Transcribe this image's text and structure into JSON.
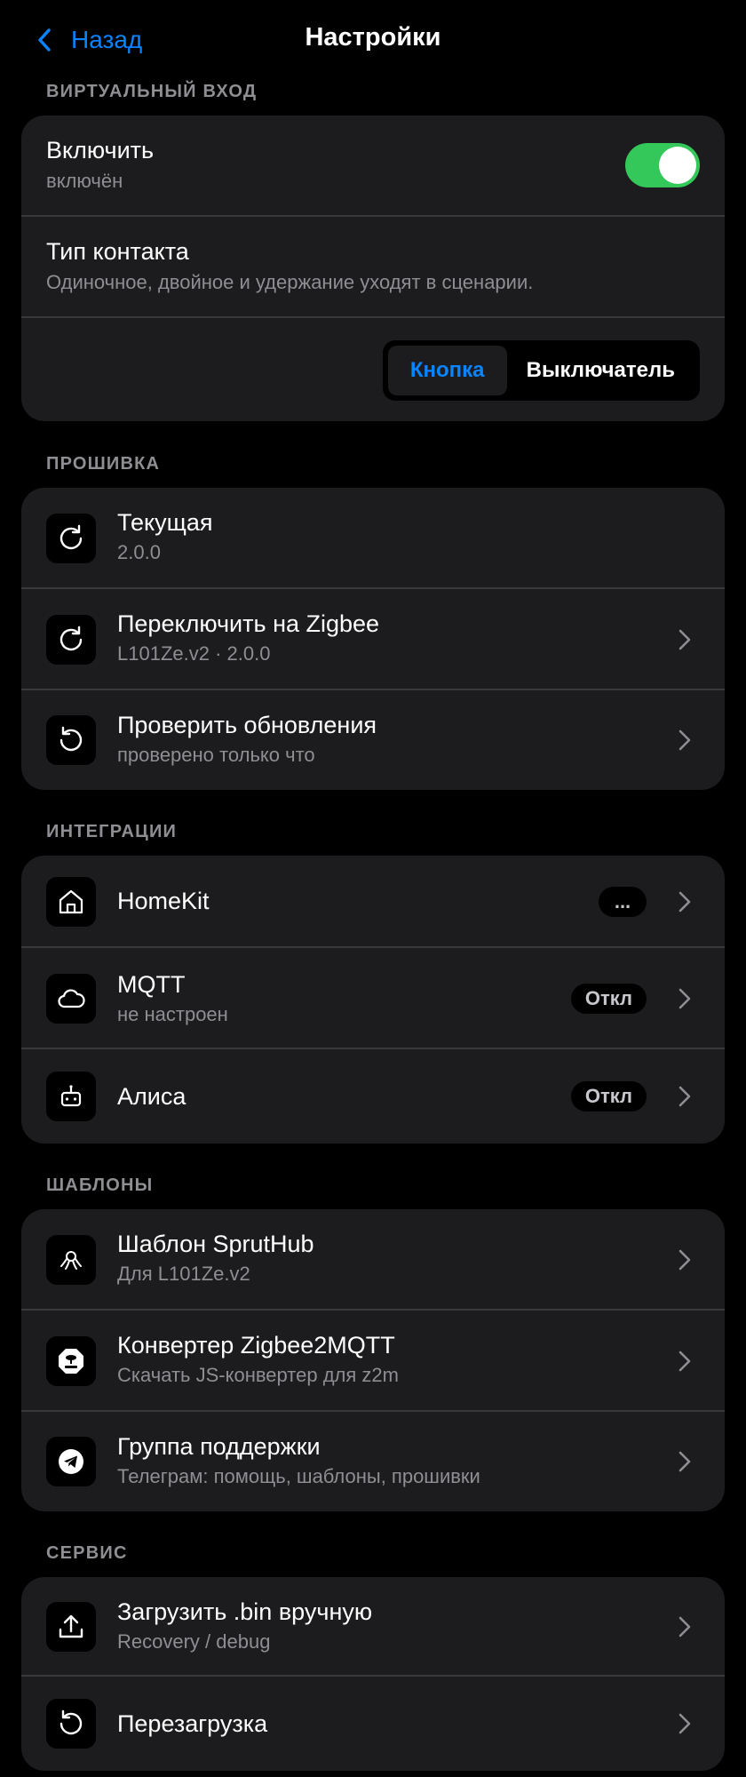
{
  "header": {
    "back_label": "Назад",
    "title": "Настройки"
  },
  "virtual": {
    "section": "ВИРТУАЛЬНЫЙ ВХОД",
    "enable_title": "Включить",
    "enable_state": "включён",
    "enable_on": true,
    "contact_title": "Тип контакта",
    "contact_desc": "Одиночное, двойное и удержание уходят в сценарии.",
    "seg_options": [
      "Кнопка",
      "Выключатель"
    ],
    "seg_selected": "Кнопка"
  },
  "firmware": {
    "section": "ПРОШИВКА",
    "items": [
      {
        "title": "Текущая",
        "subtitle": "2.0.0",
        "icon": "refresh-icon"
      },
      {
        "title": "Переключить на Zigbee",
        "subtitle": "L101Ze.v2 · 2.0.0",
        "icon": "refresh-icon"
      },
      {
        "title": "Проверить обновления",
        "subtitle": "проверено только что",
        "icon": "rotate-ccw-icon"
      }
    ]
  },
  "integrations": {
    "section": "ИНТЕГРАЦИИ",
    "items": [
      {
        "title": "HomeKit",
        "badge": "...",
        "icon": "home-icon"
      },
      {
        "title": "MQTT",
        "subtitle": "не настроен",
        "badge": "Откл",
        "icon": "cloud-icon"
      },
      {
        "title": "Алиса",
        "badge": "Откл",
        "icon": "robot-icon"
      }
    ]
  },
  "templates": {
    "section": "ШАБЛОНЫ",
    "items": [
      {
        "title": "Шаблон SprutHub",
        "subtitle": "Для L101Ze.v2",
        "icon": "octopus-icon"
      },
      {
        "title": "Конвертер Zigbee2MQTT",
        "subtitle": "Скачать JS-конвертер для z2m",
        "icon": "z2m-bee-icon"
      },
      {
        "title": "Группа поддержки",
        "subtitle": "Телеграм: помощь, шаблоны, прошивки",
        "icon": "telegram-icon"
      }
    ]
  },
  "service": {
    "section": "СЕРВИС",
    "items": [
      {
        "title": "Загрузить .bin вручную",
        "subtitle": "Recovery / debug",
        "icon": "upload-icon"
      },
      {
        "title": "Перезагрузка",
        "icon": "rotate-ccw-icon"
      }
    ]
  },
  "colors": {
    "accent": "#0a84ff",
    "toggle_on": "#34c759",
    "card": "#1c1c1e",
    "secondary_text": "#8e8e93"
  }
}
